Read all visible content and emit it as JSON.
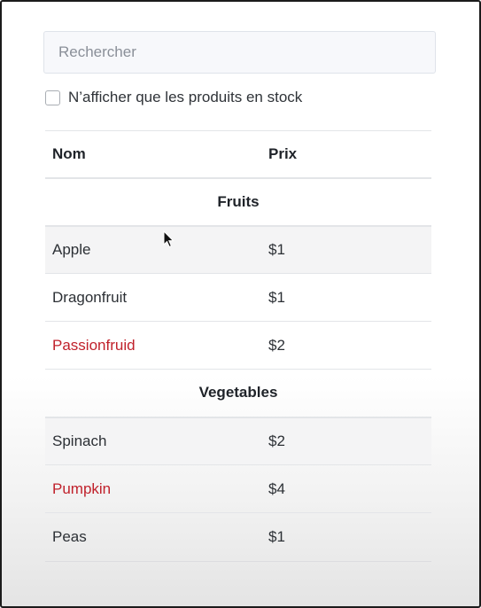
{
  "search": {
    "placeholder": "Rechercher",
    "value": ""
  },
  "stock_filter": {
    "label": "N’afficher que les produits en stock",
    "checked": false
  },
  "table": {
    "headers": {
      "name": "Nom",
      "price": "Prix"
    },
    "categories": [
      {
        "name": "Fruits",
        "products": [
          {
            "name": "Apple",
            "price": "$1",
            "stocked": true
          },
          {
            "name": "Dragonfruit",
            "price": "$1",
            "stocked": true
          },
          {
            "name": "Passionfruid",
            "price": "$2",
            "stocked": false
          }
        ]
      },
      {
        "name": "Vegetables",
        "products": [
          {
            "name": "Spinach",
            "price": "$2",
            "stocked": true
          },
          {
            "name": "Pumpkin",
            "price": "$4",
            "stocked": false
          },
          {
            "name": "Peas",
            "price": "$1",
            "stocked": true
          }
        ]
      }
    ]
  },
  "colors": {
    "out_of_stock": "#c0212b",
    "text": "#2c3035"
  },
  "icons": {
    "cursor": "mouse-pointer-icon"
  }
}
